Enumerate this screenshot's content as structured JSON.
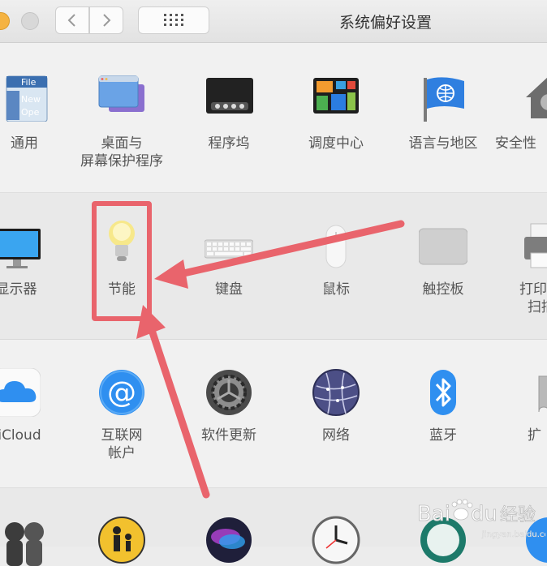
{
  "window": {
    "title": "系统偏好设置",
    "accent_color": "#e9646c"
  },
  "toolbar": {
    "back_icon": "chevron-left-icon",
    "forward_icon": "chevron-right-icon",
    "grid_icon": "grid-icon"
  },
  "rows": [
    {
      "items": [
        {
          "label": "通用",
          "icon": "general-file-icon"
        },
        {
          "label": "桌面与\n屏幕保护程序",
          "icon": "desktop-screensaver-icon"
        },
        {
          "label": "程序坞",
          "icon": "dock-icon"
        },
        {
          "label": "调度中心",
          "icon": "mission-control-icon"
        },
        {
          "label": "语言与地区",
          "icon": "language-region-flag-icon"
        },
        {
          "label": "安全性",
          "icon": "security-house-icon"
        }
      ]
    },
    {
      "items": [
        {
          "label": "显示器",
          "icon": "display-monitor-icon"
        },
        {
          "label": "节能",
          "icon": "energy-saver-bulb-icon"
        },
        {
          "label": "键盘",
          "icon": "keyboard-icon"
        },
        {
          "label": "鼠标",
          "icon": "mouse-icon"
        },
        {
          "label": "触控板",
          "icon": "trackpad-icon"
        },
        {
          "label": "打印\n扫描",
          "icon": "printer-icon"
        }
      ]
    },
    {
      "items": [
        {
          "label": "iCloud",
          "icon": "icloud-icon"
        },
        {
          "label": "互联网\n帐户",
          "icon": "internet-accounts-at-icon"
        },
        {
          "label": "软件更新",
          "icon": "software-update-gear-icon"
        },
        {
          "label": "网络",
          "icon": "network-globe-icon"
        },
        {
          "label": "蓝牙",
          "icon": "bluetooth-icon"
        },
        {
          "label": "扩",
          "icon": "extensions-puzzle-icon"
        }
      ]
    },
    {
      "items": [
        {
          "label": "",
          "icon": "users-groups-icon"
        },
        {
          "label": "",
          "icon": "parental-controls-icon"
        },
        {
          "label": "",
          "icon": "siri-icon"
        },
        {
          "label": "",
          "icon": "date-time-clock-icon"
        },
        {
          "label": "",
          "icon": "time-machine-icon"
        },
        {
          "label": "",
          "icon": "accessibility-icon"
        }
      ]
    }
  ],
  "watermark": {
    "brand": "Bai",
    "brand_tail": "du",
    "product": "经验",
    "url": "jingyan.baidu.com"
  }
}
